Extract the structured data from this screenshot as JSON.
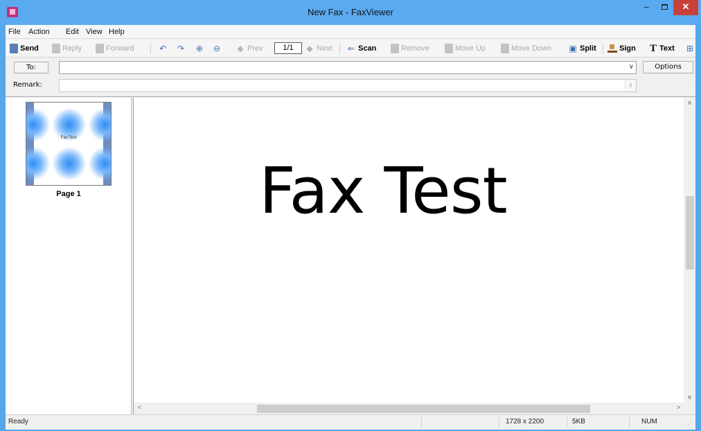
{
  "window": {
    "title": "New Fax - FaxViewer",
    "minimize_glyph": "–",
    "close_glyph": "✕"
  },
  "menu": [
    "File",
    "Action",
    "Edit",
    "View",
    "Help"
  ],
  "toolbar": {
    "send": "Send",
    "reply": "Reply",
    "forward": "Forward",
    "prev": "Prev",
    "page_indicator": "1/1",
    "next": "Next",
    "scan": "Scan",
    "remove": "Remove",
    "move_up": "Move Up",
    "move_down": "Move Down",
    "split": "Split",
    "sign": "Sign",
    "text": "Text"
  },
  "address": {
    "to_button": "To:",
    "to_value": "",
    "options_button": "Options",
    "remark_label": "Remark:",
    "remark_value": ""
  },
  "thumbnails": [
    {
      "label": "Page 1",
      "preview_text": "Fax Test"
    }
  ],
  "document": {
    "content_text": "Fax Test"
  },
  "status": {
    "state": "Ready",
    "dimensions": "1728 x 2200",
    "size": "5KB",
    "num_lock": "NUM"
  },
  "colors": {
    "titlebar": "#5aaaf0",
    "close_button": "#c7413a",
    "app_icon": "#c2307a"
  }
}
